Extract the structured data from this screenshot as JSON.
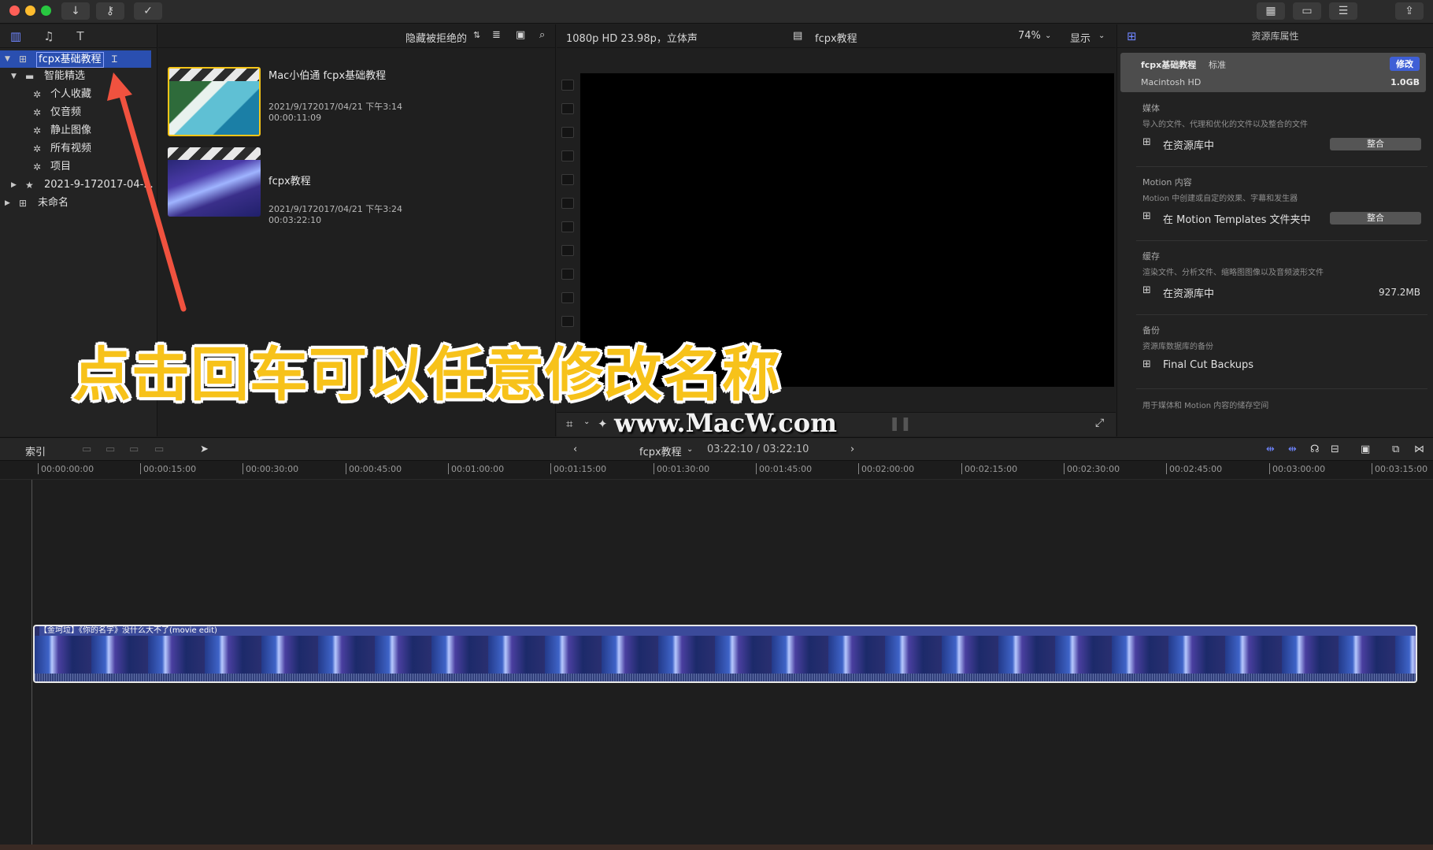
{
  "titlebar": {
    "buttons": [
      {
        "icon": "download-icon",
        "glyph": "↓"
      },
      {
        "icon": "key-icon",
        "glyph": "⚷"
      },
      {
        "icon": "check-circle-icon",
        "glyph": "✓"
      }
    ],
    "right_buttons": [
      {
        "icon": "grid-icon",
        "glyph": "▦"
      },
      {
        "icon": "film-strip-icon",
        "glyph": "▭"
      },
      {
        "icon": "sliders-icon",
        "glyph": "☰"
      },
      {
        "icon": "share-icon",
        "glyph": "⇪"
      }
    ]
  },
  "sidebar": {
    "library": "fcpx基础教程",
    "smart_collections": "智能精选",
    "items": [
      "个人收藏",
      "仅音频",
      "静止图像",
      "所有视频",
      "项目"
    ],
    "event": "2021-9-172017-04-...",
    "other_library": "未命名"
  },
  "browser": {
    "filter_label": "隐藏被拒绝的",
    "clips": [
      {
        "title": "Mac小伯通 fcpx基础教程",
        "date": "2021/9/172017/04/21 下午3:14",
        "duration": "00:00:11:09"
      },
      {
        "title": "fcpx教程",
        "date": "2021/9/172017/04/21 下午3:24",
        "duration": "00:03:22:10"
      }
    ]
  },
  "viewer": {
    "format": "1080p HD 23.98p，立体声",
    "project": "fcpx教程",
    "zoom": "74%",
    "display": "显示"
  },
  "inspector": {
    "title": "资源库属性",
    "library_name": "fcpx基础教程",
    "library_type": "标准",
    "modify": "修改",
    "disk": "Macintosh HD",
    "disk_size": "1.0GB",
    "media_title": "媒体",
    "media_desc": "导入的文件、代理和优化的文件以及整合的文件",
    "media_loc": "在资源库中",
    "consolidate": "整合",
    "motion_title": "Motion 内容",
    "motion_desc": "Motion 中创建或自定的效果、字幕和发生器",
    "motion_loc": "在 Motion Templates 文件夹中",
    "cache_title": "缓存",
    "cache_desc": "渲染文件、分析文件、缩略图图像以及音频波形文件",
    "cache_loc": "在资源库中",
    "cache_size": "927.2MB",
    "backup_title": "备份",
    "backup_desc": "资源库数据库的备份",
    "backup_loc": "Final Cut Backups",
    "storage_desc": "用于媒体和 Motion 内容的储存空间"
  },
  "timeline": {
    "index": "索引",
    "project": "fcpx教程",
    "timecode": "03:22:10 / 03:22:10",
    "ruler": [
      "00:00:00:00",
      "00:00:15:00",
      "00:00:30:00",
      "00:00:45:00",
      "00:01:00:00",
      "00:01:15:00",
      "00:01:30:00",
      "00:01:45:00",
      "00:02:00:00",
      "00:02:15:00",
      "00:02:30:00",
      "00:02:45:00",
      "00:03:00:00",
      "00:03:15:00"
    ],
    "clip_label": "【金坷垃】《你的名字》没什么大不了(movie edit)"
  },
  "overlay": {
    "caption": "点击回车可以任意修改名称",
    "watermark": "www.MacW.com"
  },
  "colors": {
    "accent": "#2a4fb0",
    "caption": "#f7c21a"
  }
}
